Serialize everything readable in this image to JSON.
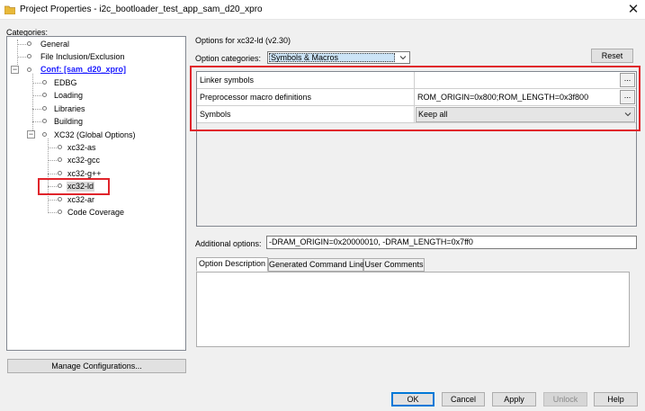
{
  "window": {
    "title": "Project Properties - i2c_bootloader_test_app_sam_d20_xpro",
    "close_glyph": "✕"
  },
  "categories": {
    "label": "Categories:",
    "items": [
      {
        "label": "General"
      },
      {
        "label": "File Inclusion/Exclusion"
      },
      {
        "label": "Conf: [sam_d20_xpro]",
        "expander": "−"
      },
      {
        "label": "EDBG"
      },
      {
        "label": "Loading"
      },
      {
        "label": "Libraries"
      },
      {
        "label": "Building"
      },
      {
        "label": "XC32 (Global Options)",
        "expander": "−"
      },
      {
        "label": "xc32-as"
      },
      {
        "label": "xc32-gcc"
      },
      {
        "label": "xc32-g++"
      },
      {
        "label": "xc32-ld"
      },
      {
        "label": "xc32-ar"
      },
      {
        "label": "Code Coverage"
      }
    ]
  },
  "manage_button": "Manage Configurations...",
  "options_for": "Options for xc32-ld (v2.30)",
  "option_categories": {
    "label": "Option categories:",
    "selected": "Symbols & Macros"
  },
  "reset_button": "Reset",
  "properties": [
    {
      "name": "Linker symbols",
      "value": "",
      "ellipsis": "..."
    },
    {
      "name": "Preprocessor macro definitions",
      "value": "ROM_ORIGIN=0x800;ROM_LENGTH=0x3f800",
      "ellipsis": "..."
    },
    {
      "name": "Symbols",
      "value": "Keep all"
    }
  ],
  "additional_options": {
    "label": "Additional options:",
    "value": "-DRAM_ORIGIN=0x20000010, -DRAM_LENGTH=0x7ff0"
  },
  "tabs": [
    {
      "label": "Option Description"
    },
    {
      "label": "Generated Command Line"
    },
    {
      "label": "User Comments"
    }
  ],
  "buttons": {
    "ok": "OK",
    "cancel": "Cancel",
    "apply": "Apply",
    "unlock": "Unlock",
    "help": "Help"
  },
  "colors": {
    "highlight": "#e0242b",
    "link": "#1a1aff",
    "default_button_border": "#0078d7"
  }
}
